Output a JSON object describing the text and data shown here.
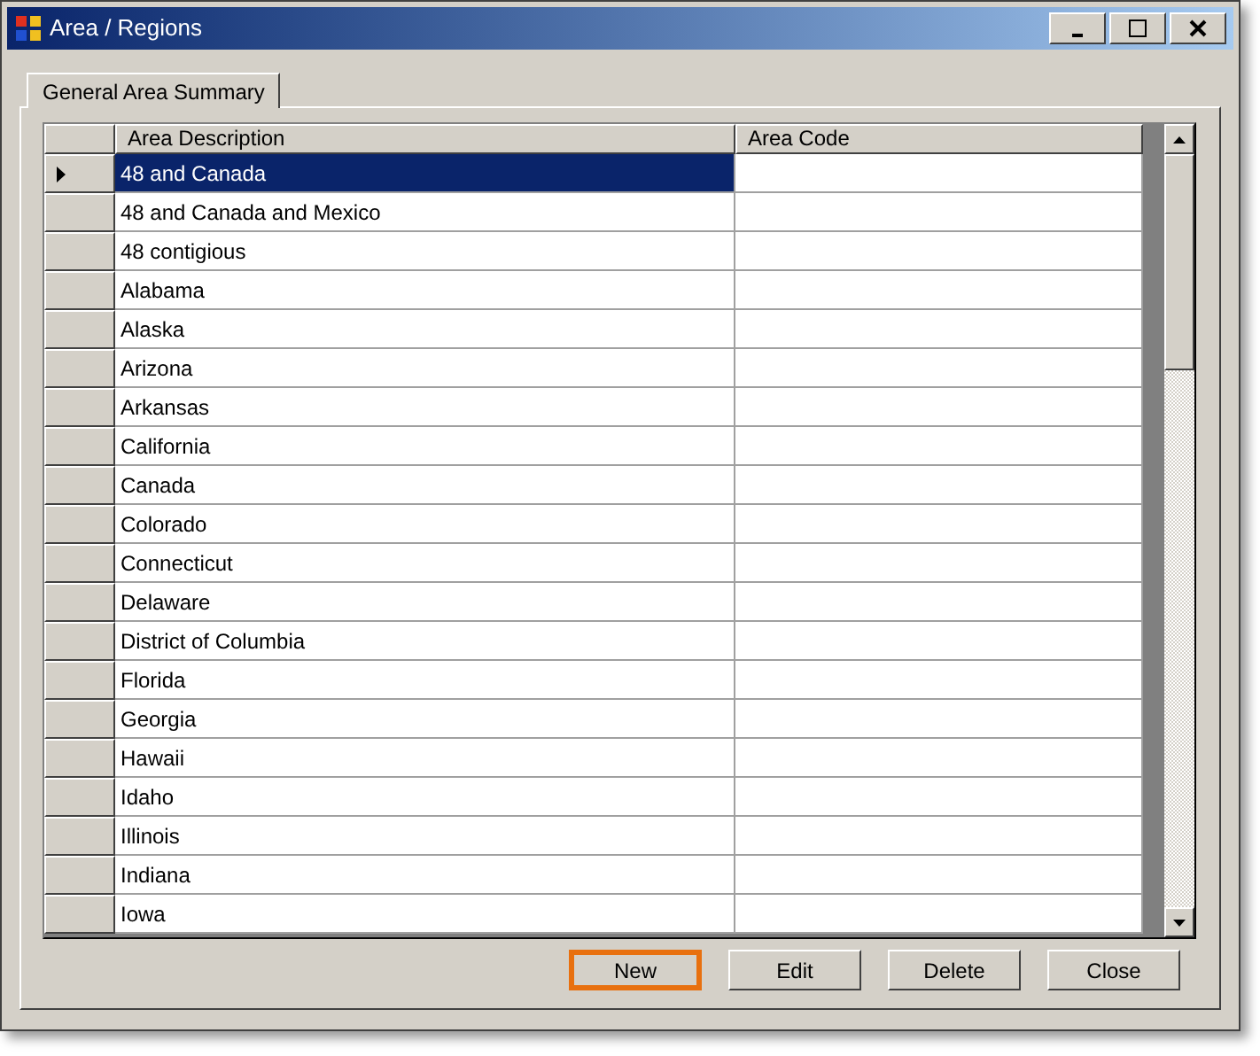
{
  "window": {
    "title": "Area / Regions"
  },
  "tabs": [
    {
      "label": "General Area Summary",
      "selected": true
    }
  ],
  "table": {
    "columns": [
      "Area Description",
      "Area Code"
    ],
    "rows": [
      {
        "description": "48 and Canada",
        "selected": true
      },
      {
        "description": "48 and Canada and Mexico",
        "selected": false
      },
      {
        "description": "48 contigious",
        "selected": false
      },
      {
        "description": "Alabama",
        "selected": false
      },
      {
        "description": "Alaska",
        "selected": false
      },
      {
        "description": "Arizona",
        "selected": false
      },
      {
        "description": "Arkansas",
        "selected": false
      },
      {
        "description": "California",
        "selected": false
      },
      {
        "description": "Canada",
        "selected": false
      },
      {
        "description": "Colorado",
        "selected": false
      },
      {
        "description": "Connecticut",
        "selected": false
      },
      {
        "description": "Delaware",
        "selected": false
      },
      {
        "description": "District of Columbia",
        "selected": false
      },
      {
        "description": "Florida",
        "selected": false
      },
      {
        "description": "Georgia",
        "selected": false
      },
      {
        "description": "Hawaii",
        "selected": false
      },
      {
        "description": "Idaho",
        "selected": false
      },
      {
        "description": "Illinois",
        "selected": false
      },
      {
        "description": "Indiana",
        "selected": false
      },
      {
        "description": "Iowa",
        "selected": false
      }
    ]
  },
  "buttons": [
    {
      "label": "New",
      "highlighted": true
    },
    {
      "label": "Edit",
      "highlighted": false
    },
    {
      "label": "Delete",
      "highlighted": false
    },
    {
      "label": "Close",
      "highlighted": false
    }
  ]
}
